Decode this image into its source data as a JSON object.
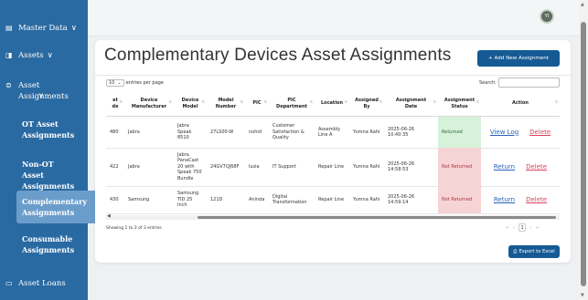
{
  "sidebar": {
    "items": [
      {
        "label": "Master Data",
        "icon": "database-icon",
        "chevron": "∨"
      },
      {
        "label": "Assets",
        "icon": "assets-icon",
        "chevron": "∨"
      },
      {
        "label": "Asset Assignments",
        "icon": "assignments-icon",
        "chevron": "∨"
      }
    ],
    "subitems": [
      {
        "label": "OT Asset Assignments"
      },
      {
        "label": "Non-OT Asset Assignments"
      },
      {
        "label": "Complementary Assignments"
      },
      {
        "label": "Consumable Assignments"
      }
    ],
    "bottom": {
      "label": "Asset Loans",
      "icon": "calendar-icon"
    }
  },
  "header": {
    "avatar_initials": "YI"
  },
  "page": {
    "title": "Complementary Devices Asset Assignments",
    "add_button": "+ Add New Assignment",
    "length_value": "10",
    "length_suffix": "entries per page",
    "search_label": "Search:",
    "search_value": "",
    "info": "Showing 1 to 3 of 3 entries",
    "pager": {
      "first": "«",
      "prev": "‹",
      "current": "1",
      "next": "›",
      "last": "»"
    },
    "export_button": "Export to Excel"
  },
  "table": {
    "columns": [
      "et\nde",
      "Device\nManufacturer",
      "Device\nModel",
      "Model\nNumber",
      "PIC",
      "PIC\nDepartment",
      "Location",
      "Assigned\nBy",
      "Assignment\nDate",
      "Assignment\nStatus",
      "Action"
    ],
    "rows": [
      {
        "code": "480",
        "manufacturer": "Jabra",
        "model": "Jabra\nSpeak\n8510",
        "model_number": "27LS00-W",
        "pic": "nohid",
        "department": "Customer\nSatisfaction &\nQuality",
        "location": "Assembly\nLine A",
        "assigned_by": "Yumna Rahi",
        "date": "2025-06-26\n10:40:35",
        "status": "Returned",
        "status_type": "returned",
        "action1": "View Log",
        "action2": "Delete"
      },
      {
        "code": "422",
        "manufacturer": "Jabra",
        "model": "Jabra\nPanaCast\n20 with\nSpeak 750\nBundle",
        "model_number": "24GV7QJ68F",
        "pic": "lusia",
        "department": "IT Support",
        "location": "Repair Line",
        "assigned_by": "Yumna Rahi",
        "date": "2025-06-26\n14:58:53",
        "status": "Not Returned",
        "status_type": "not",
        "action1": "Return",
        "action2": "Delete"
      },
      {
        "code": "430",
        "manufacturer": "Samsung",
        "model": "Samsung\nTID 25\nInch",
        "model_number": "121D",
        "pic": "Aninda",
        "department": "Digital\nTransformation",
        "location": "Repair Line",
        "assigned_by": "Yumna Rahi",
        "date": "2025-06-26\n14:59:14",
        "status": "Not Returned",
        "status_type": "not",
        "action1": "Return",
        "action2": "Delete"
      }
    ]
  }
}
